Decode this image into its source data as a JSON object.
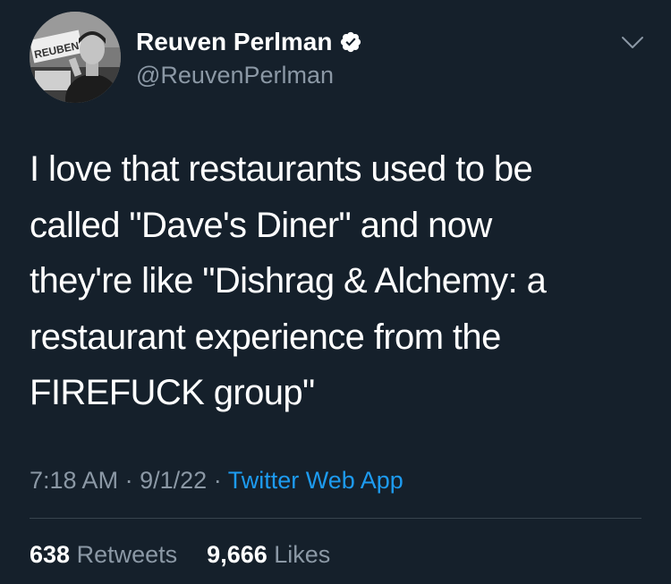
{
  "author": {
    "name": "Reuven Perlman",
    "handle": "@ReuvenPerlman",
    "verified_icon": "verified-badge-icon",
    "avatar_sign_text": "REUBEN"
  },
  "tweet": {
    "text": "I love that restaurants used to be\ncalled \"Dave's Diner\" and now\nthey're like \"Dishrag & Alchemy: a\nrestaurant experience from the\nFIREFUCK group\""
  },
  "meta": {
    "time": "7:18 AM",
    "separator": "·",
    "date": "9/1/22",
    "source": "Twitter Web App"
  },
  "stats": {
    "retweets_count": "638",
    "retweets_label": "Retweets",
    "likes_count": "9,666",
    "likes_label": "Likes"
  },
  "colors": {
    "background": "#15202b",
    "secondary_text": "#8b98a5",
    "link": "#1d9bf0",
    "divider": "#38444d"
  }
}
